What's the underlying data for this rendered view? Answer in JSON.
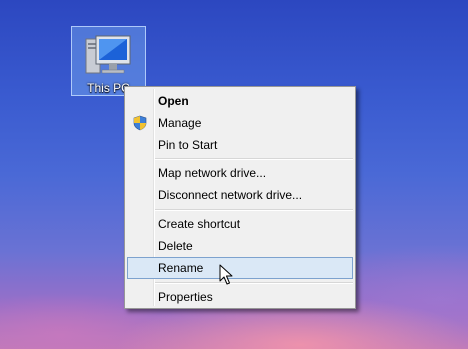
{
  "desktop": {
    "icon_label": "This PC"
  },
  "context_menu": {
    "items": [
      {
        "label": "Open",
        "bold": true
      },
      {
        "label": "Manage",
        "icon": "uac-shield-icon"
      },
      {
        "label": "Pin to Start"
      },
      {
        "label": "Map network drive..."
      },
      {
        "label": "Disconnect network drive..."
      },
      {
        "label": "Create shortcut"
      },
      {
        "label": "Delete"
      },
      {
        "label": "Rename",
        "highlighted": true
      },
      {
        "label": "Properties"
      }
    ]
  },
  "colors": {
    "menu_background": "#f0f0f0",
    "menu_border": "#979797",
    "highlight_fill": "#dae8f6",
    "highlight_border": "#7da2ce",
    "selection_fill": "#78aaf0"
  },
  "icons": [
    "this-pc-icon",
    "uac-shield-icon",
    "mouse-pointer-icon"
  ]
}
